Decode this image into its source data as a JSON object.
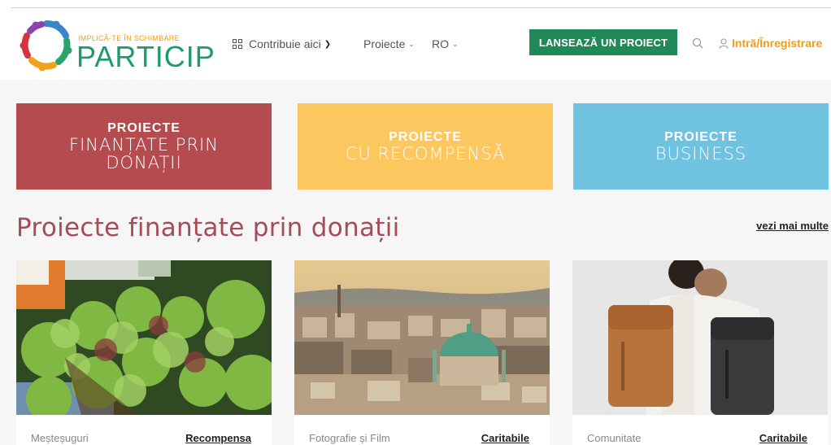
{
  "header": {
    "logo": {
      "tagline": "IMPLICĂ-TE ÎN SCHIMBARE",
      "brand": "PARTICIP",
      "icon": "people-circle-logo"
    },
    "nav": {
      "contribute": "Contribuie aici",
      "projects": "Proiecte",
      "language": "RO"
    },
    "launch_button": "LANSEAZĂ UN PROIECT",
    "search_icon": "search-icon",
    "login": "Intră/Înregistrare"
  },
  "categories": [
    {
      "line1": "PROIECTE",
      "line2": "FINANȚATE PRIN",
      "line3": "DONAȚII",
      "color": "#b44b4f"
    },
    {
      "line1": "PROIECTE",
      "line2": "CU RECOMPENSĂ",
      "color": "#fcc75f"
    },
    {
      "line1": "PROIECTE",
      "line2": "BUSINESS",
      "color": "#6fc2e0"
    }
  ],
  "section": {
    "title": "Proiecte finanțate prin donații",
    "more": "vezi mai multe"
  },
  "cards": [
    {
      "image": "lettuce-market-photo",
      "category": "Meșteșuguri",
      "type": "Recompensa"
    },
    {
      "image": "city-panorama-photo",
      "category": "Fotografie și Film",
      "type": "Caritabile"
    },
    {
      "image": "backpacks-couple-photo",
      "category": "Comunitate",
      "type": "Caritabile"
    }
  ],
  "colors": {
    "brand_green": "#1f8a57",
    "accent_orange": "#f39c12",
    "title_red": "#a64b57"
  }
}
